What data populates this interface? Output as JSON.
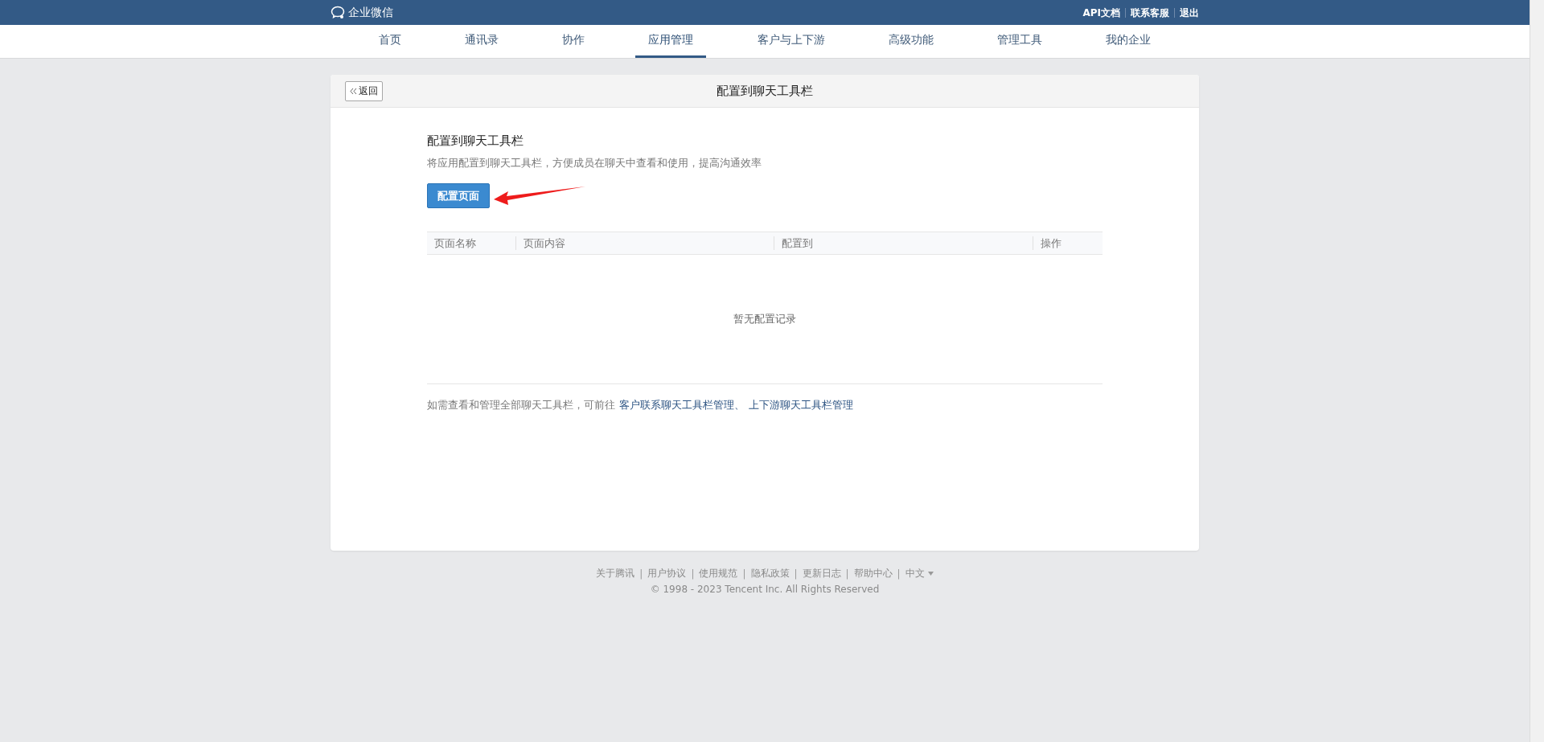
{
  "top_bar": {
    "logo": "企业微信",
    "links": [
      {
        "label": "API文档"
      },
      {
        "label": "联系客服"
      },
      {
        "label": "退出"
      }
    ]
  },
  "nav": [
    {
      "label": "首页",
      "selected": false
    },
    {
      "label": "通讯录",
      "selected": false
    },
    {
      "label": "协作",
      "selected": false
    },
    {
      "label": "应用管理",
      "selected": true
    },
    {
      "label": "客户与上下游",
      "selected": false
    },
    {
      "label": "高级功能",
      "selected": false
    },
    {
      "label": "管理工具",
      "selected": false
    },
    {
      "label": "我的企业",
      "selected": false
    }
  ],
  "panel": {
    "back_button": "返回",
    "title": "配置到聊天工具栏",
    "section_title": "配置到聊天工具栏",
    "description": "将应用配置到聊天工具栏，方便成员在聊天中查看和使用，提高沟通效率",
    "primary_button": "配置页面",
    "table": {
      "columns": [
        "页面名称",
        "页面内容",
        "配置到",
        "操作"
      ],
      "empty_text": "暂无配置记录"
    },
    "note": {
      "text": "如需查看和管理全部聊天工具栏，可前往",
      "links": [
        "客户联系聊天工具栏管理、",
        "上下游聊天工具栏管理"
      ]
    }
  },
  "footer": {
    "links": [
      {
        "label": "关于腾讯",
        "separator": "|"
      },
      {
        "label": "用户协议",
        "separator": "|"
      },
      {
        "label": "使用规范",
        "separator": "|"
      },
      {
        "label": "隐私政策",
        "separator": "|"
      },
      {
        "label": "更新日志",
        "separator": "|"
      },
      {
        "label": "帮助中心",
        "separator": "|"
      },
      {
        "label": "中文"
      }
    ],
    "copyright": "© 1998 - 2023 Tencent Inc. All Rights Reserved"
  }
}
